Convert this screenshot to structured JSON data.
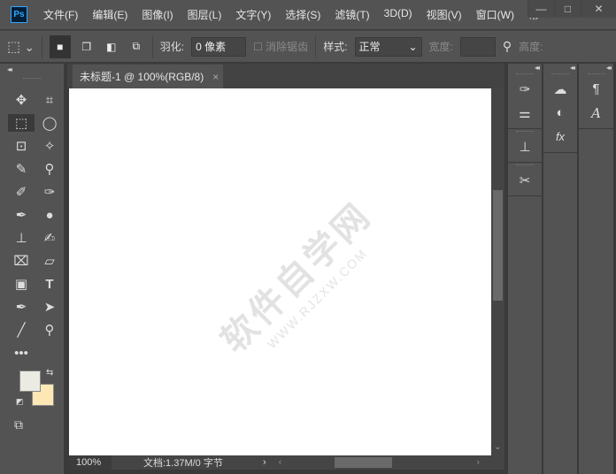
{
  "app": {
    "logo": "Ps"
  },
  "menu": [
    "文件(F)",
    "编辑(E)",
    "图像(I)",
    "图层(L)",
    "文字(Y)",
    "选择(S)",
    "滤镜(T)",
    "3D(D)",
    "视图(V)",
    "窗口(W)",
    "帮"
  ],
  "window_controls": {
    "minimize": "—",
    "maximize": "□",
    "close": "✕"
  },
  "options": {
    "feather_label": "羽化:",
    "feather_value": "0 像素",
    "antialias_label": "消除锯齿",
    "style_label": "样式:",
    "style_value": "正常",
    "width_label": "宽度:",
    "height_label": "高度:"
  },
  "document": {
    "tab_title": "未标题-1 @ 100%(RGB/8)",
    "close": "×"
  },
  "watermark": {
    "main": "软件自学网",
    "url": "WWW.RJZXW.COM"
  },
  "status": {
    "zoom": "100%",
    "doc_info": "文档:1.37M/0 字节"
  },
  "colors": {
    "foreground": "#ebebe3",
    "background": "#fde8b5",
    "accent": "#31a8ff"
  }
}
